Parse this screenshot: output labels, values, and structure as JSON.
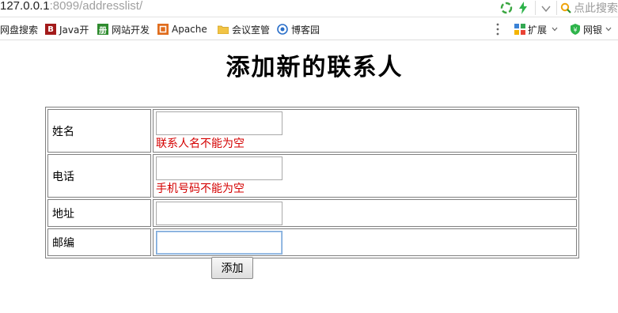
{
  "browser": {
    "url_host": "127.0.0.1",
    "url_rest": ":8099/addresslist/",
    "search_placeholder": "点此搜索"
  },
  "bookmarks": {
    "items": [
      {
        "label": "网盘搜索",
        "icon": "none"
      },
      {
        "label": "Java开",
        "icon": "B-badge-icon",
        "icon_text": "B",
        "color": "#a31b1b"
      },
      {
        "label": "网站开发",
        "icon": "book-icon",
        "icon_text": "册",
        "color": "#2e8b2e"
      },
      {
        "label": "Apache",
        "icon": "apache-icon",
        "icon_text": "",
        "color": "#e06d1e"
      },
      {
        "label": "会议室管",
        "icon": "folder-icon",
        "color": "#f2c445"
      },
      {
        "label": "博客园",
        "icon": "globe-icon",
        "color": "#2a6fc9"
      }
    ],
    "extensions_label": "扩展",
    "bank_label": "网银"
  },
  "page": {
    "title": "添加新的联系人"
  },
  "form": {
    "rows": [
      {
        "label": "姓名",
        "value": "",
        "error": "联系人名不能为空"
      },
      {
        "label": "电话",
        "value": "",
        "error": "手机号码不能为空"
      },
      {
        "label": "地址",
        "value": ""
      },
      {
        "label": "邮编",
        "value": ""
      }
    ],
    "submit_label": "添加"
  },
  "colors": {
    "error": "#d40000",
    "focus_border": "#7aa7d8",
    "url_rest": "#a0a0a0"
  }
}
